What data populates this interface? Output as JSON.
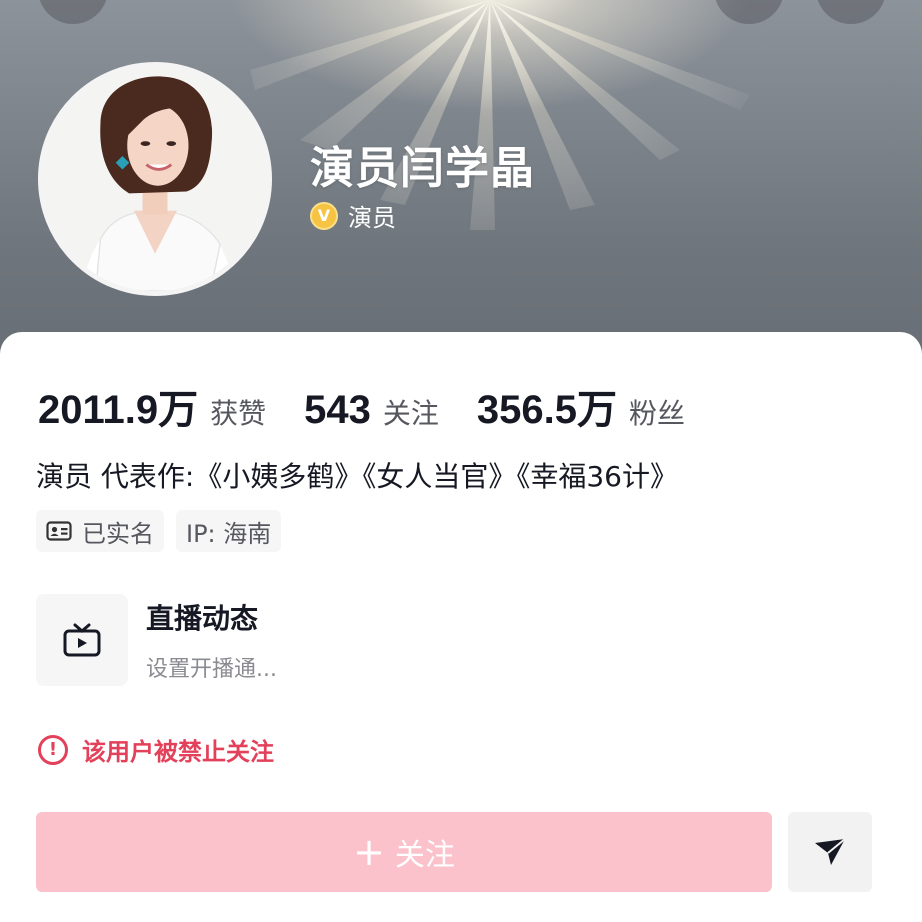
{
  "header": {
    "nickname": "演员闫学晶",
    "verification": {
      "icon": "verified-badge-icon",
      "label": "演员",
      "color": "#f6c343"
    }
  },
  "stats": [
    {
      "value": "2011.9万",
      "label": "获赞"
    },
    {
      "value": "543",
      "label": "关注"
    },
    {
      "value": "356.5万",
      "label": "粉丝"
    }
  ],
  "bio": "演员 代表作:《小姨多鹤》《女人当官》《幸福36计》",
  "tags": {
    "realname": {
      "icon": "id-card-icon",
      "label": "已实名"
    },
    "ip": "IP: 海南"
  },
  "live": {
    "icon": "tv-icon",
    "title": "直播动态",
    "subtitle": "设置开播通..."
  },
  "notice": {
    "icon": "warning-icon",
    "text": "该用户被禁止关注",
    "color": "#e3405a"
  },
  "actions": {
    "follow_icon": "plus-icon",
    "follow_label": "关注",
    "follow_color": "#fbc2cb",
    "share_icon": "paper-plane-icon"
  }
}
